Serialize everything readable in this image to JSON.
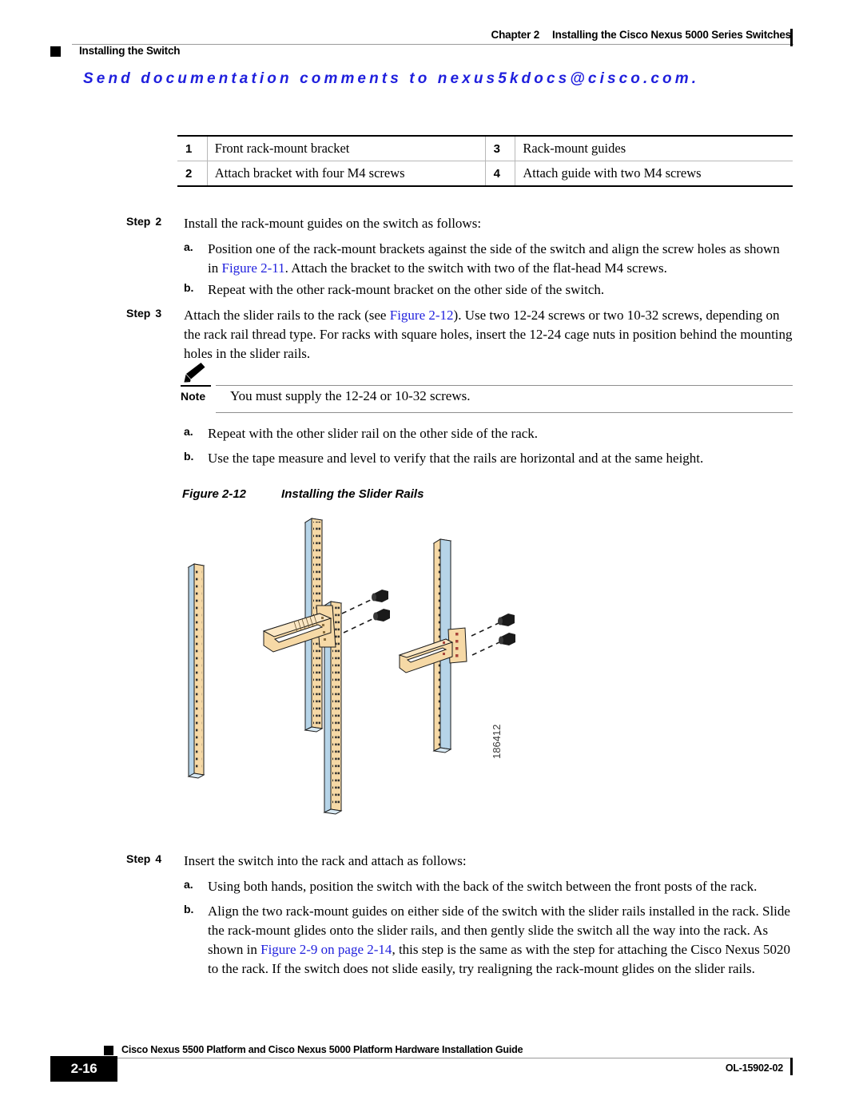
{
  "header": {
    "chapter": "Chapter 2",
    "chapter_title": "Installing the Cisco Nexus 5000 Series Switches",
    "section": "Installing the Switch",
    "send_comments": "Send documentation comments to nexus5kdocs@cisco.com.",
    "accent_color": "#1f1fdd"
  },
  "legend_table": {
    "rows": [
      {
        "num_left": "1",
        "text_left": "Front rack-mount bracket",
        "num_right": "3",
        "text_right": "Rack-mount guides"
      },
      {
        "num_left": "2",
        "text_left": "Attach bracket with four M4 screws",
        "num_right": "4",
        "text_right": "Attach guide with two M4 screws"
      }
    ]
  },
  "step2": {
    "label": "Step",
    "number": "2",
    "text": "Install the rack-mount guides on the switch as follows:",
    "a_label": "a.",
    "a_text_1": "Position one of the rack-mount brackets against the side of the switch and align the screw holes as shown in ",
    "a_xref": "Figure 2-11",
    "a_text_2": ". Attach the bracket to the switch with two of the flat-head M4 screws.",
    "b_label": "b.",
    "b_text": "Repeat with the other rack-mount bracket on the other side of the switch."
  },
  "step3": {
    "label": "Step",
    "number": "3",
    "text_1": "Attach the slider rails to the rack (see ",
    "xref": "Figure 2-12",
    "text_2": "). Use two 12-24 screws or two 10-32 screws, depending on the rack rail thread type. For racks with square holes, insert the 12-24 cage nuts in position behind the mounting holes in the slider rails.",
    "a_label": "a.",
    "a_text": "Repeat with the other slider rail on the other side of the rack.",
    "b_label": "b.",
    "b_text": "Use the tape measure and level to verify that the rails are horizontal and at the same height."
  },
  "note": {
    "icon": "pencil-icon",
    "label": "Note",
    "text": "You must supply the 12-24 or 10-32 screws."
  },
  "figure": {
    "number": "Figure 2-12",
    "title": "Installing the Slider Rails",
    "id": "186412",
    "rail_color": "#b6d4e8",
    "strip_color": "#f6d9a6",
    "screw_color": "#1a1a1a"
  },
  "step4": {
    "label": "Step",
    "number": "4",
    "text": "Insert the switch into the rack and attach as follows:",
    "a_label": "a.",
    "a_text": "Using both hands, position the switch with the back of the switch between the front posts of the rack.",
    "b_label": "b.",
    "b_text_1": "Align the two rack-mount guides on either side of the switch with the slider rails installed in the rack. Slide the rack-mount glides onto the slider rails, and then gently slide the switch all the way into the rack. As shown in ",
    "b_xref": "Figure 2-9 on page 2-14",
    "b_text_2": ", this step is the same as with the step for attaching the Cisco Nexus 5020 to the rack. If the switch does not slide easily, try realigning the rack-mount glides on the slider rails."
  },
  "footer": {
    "title": "Cisco Nexus 5500 Platform and Cisco Nexus 5000 Platform Hardware Installation Guide",
    "page": "2-16",
    "doc_id": "OL-15902-02"
  }
}
